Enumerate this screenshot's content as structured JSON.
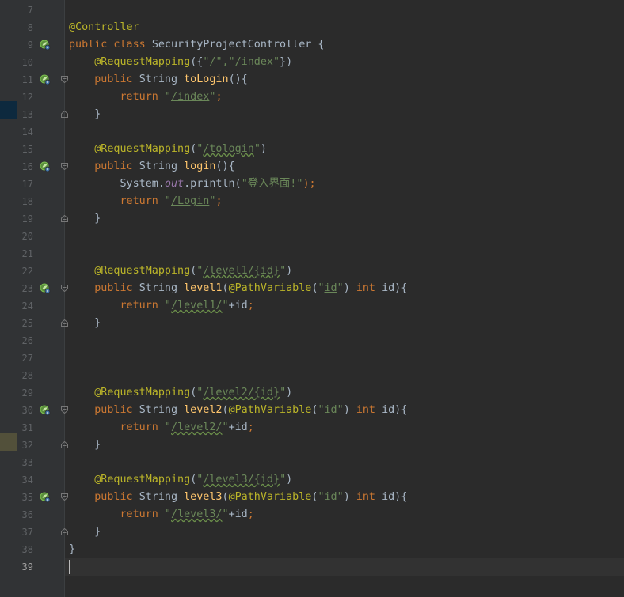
{
  "editor": {
    "first_line": 7,
    "current_line": 39,
    "colors": {
      "background": "#2b2b2b",
      "gutter": "#313335",
      "keyword": "#cc7832",
      "annotation": "#bbb529",
      "string": "#6a8759",
      "function": "#ffc66d",
      "field": "#9876aa",
      "text": "#a9b7c6"
    },
    "lines": [
      {
        "n": "7",
        "tokens": []
      },
      {
        "n": "8",
        "tokens": [
          {
            "t": "@Controller",
            "c": "ann"
          }
        ]
      },
      {
        "n": "9",
        "icon": "spring-bean-icon",
        "tokens": [
          {
            "t": "public class ",
            "c": "kw"
          },
          {
            "t": "SecurityProjectController {",
            "c": "plain"
          }
        ]
      },
      {
        "n": "10",
        "tokens": [
          {
            "t": "    "
          },
          {
            "t": "@RequestMapping",
            "c": "ann"
          },
          {
            "t": "({",
            "c": "plain"
          },
          {
            "t": "\"",
            "c": "str"
          },
          {
            "t": "/",
            "c": "strlink"
          },
          {
            "t": "\",\"",
            "c": "str"
          },
          {
            "t": "/index",
            "c": "strlink"
          },
          {
            "t": "\"",
            "c": "str"
          },
          {
            "t": "})",
            "c": "plain"
          }
        ]
      },
      {
        "n": "11",
        "icon": "request-mapping-icon",
        "fold": "open",
        "tokens": [
          {
            "t": "    "
          },
          {
            "t": "public ",
            "c": "kw"
          },
          {
            "t": "String ",
            "c": "plain"
          },
          {
            "t": "toLogin",
            "c": "fn"
          },
          {
            "t": "(){",
            "c": "plain"
          }
        ]
      },
      {
        "n": "12",
        "tokens": [
          {
            "t": "        "
          },
          {
            "t": "return ",
            "c": "kw"
          },
          {
            "t": "\"",
            "c": "str"
          },
          {
            "t": "/index",
            "c": "strlink"
          },
          {
            "t": "\"",
            "c": "str"
          },
          {
            "t": ";",
            "c": "kw"
          }
        ]
      },
      {
        "n": "13",
        "fold": "close",
        "tokens": [
          {
            "t": "    "
          },
          {
            "t": "}",
            "c": "plain"
          }
        ]
      },
      {
        "n": "14",
        "tokens": []
      },
      {
        "n": "15",
        "tokens": [
          {
            "t": "    "
          },
          {
            "t": "@RequestMapping",
            "c": "ann"
          },
          {
            "t": "(",
            "c": "plain"
          },
          {
            "t": "\"",
            "c": "str"
          },
          {
            "t": "/tologin",
            "c": "strlink wavy"
          },
          {
            "t": "\"",
            "c": "str"
          },
          {
            "t": ")",
            "c": "plain"
          }
        ]
      },
      {
        "n": "16",
        "icon": "request-mapping-icon",
        "fold": "open",
        "tokens": [
          {
            "t": "    "
          },
          {
            "t": "public ",
            "c": "kw"
          },
          {
            "t": "String ",
            "c": "plain"
          },
          {
            "t": "login",
            "c": "fn"
          },
          {
            "t": "(){",
            "c": "plain"
          }
        ]
      },
      {
        "n": "17",
        "tokens": [
          {
            "t": "        "
          },
          {
            "t": "System.",
            "c": "plain"
          },
          {
            "t": "out",
            "c": "field"
          },
          {
            "t": ".println(",
            "c": "plain"
          },
          {
            "t": "\"登入界面!\"",
            "c": "str"
          },
          {
            "t": ");",
            "c": "kw"
          }
        ]
      },
      {
        "n": "18",
        "tokens": [
          {
            "t": "        "
          },
          {
            "t": "return ",
            "c": "kw"
          },
          {
            "t": "\"",
            "c": "str"
          },
          {
            "t": "/Login",
            "c": "strlink"
          },
          {
            "t": "\"",
            "c": "str"
          },
          {
            "t": ";",
            "c": "kw"
          }
        ]
      },
      {
        "n": "19",
        "fold": "close",
        "tokens": [
          {
            "t": "    "
          },
          {
            "t": "}",
            "c": "plain"
          }
        ]
      },
      {
        "n": "20",
        "tokens": []
      },
      {
        "n": "21",
        "tokens": []
      },
      {
        "n": "22",
        "tokens": [
          {
            "t": "    "
          },
          {
            "t": "@RequestMapping",
            "c": "ann"
          },
          {
            "t": "(",
            "c": "plain"
          },
          {
            "t": "\"",
            "c": "str"
          },
          {
            "t": "/level1/{id}",
            "c": "strlink wavy"
          },
          {
            "t": "\"",
            "c": "str"
          },
          {
            "t": ")",
            "c": "plain"
          }
        ]
      },
      {
        "n": "23",
        "icon": "request-mapping-icon",
        "fold": "open",
        "tokens": [
          {
            "t": "    "
          },
          {
            "t": "public ",
            "c": "kw"
          },
          {
            "t": "String ",
            "c": "plain"
          },
          {
            "t": "level1",
            "c": "fn"
          },
          {
            "t": "(",
            "c": "plain"
          },
          {
            "t": "@PathVariable",
            "c": "ann"
          },
          {
            "t": "(",
            "c": "plain"
          },
          {
            "t": "\"",
            "c": "str"
          },
          {
            "t": "id",
            "c": "strlink"
          },
          {
            "t": "\"",
            "c": "str"
          },
          {
            "t": ") ",
            "c": "plain"
          },
          {
            "t": "int ",
            "c": "kw"
          },
          {
            "t": "id){",
            "c": "plain"
          }
        ]
      },
      {
        "n": "24",
        "tokens": [
          {
            "t": "        "
          },
          {
            "t": "return ",
            "c": "kw"
          },
          {
            "t": "\"",
            "c": "str"
          },
          {
            "t": "/level1/",
            "c": "str wavy"
          },
          {
            "t": "\"",
            "c": "str"
          },
          {
            "t": "+id",
            "c": "plain"
          },
          {
            "t": ";",
            "c": "kw"
          }
        ]
      },
      {
        "n": "25",
        "fold": "close",
        "tokens": [
          {
            "t": "    "
          },
          {
            "t": "}",
            "c": "plain"
          }
        ]
      },
      {
        "n": "26",
        "tokens": []
      },
      {
        "n": "27",
        "tokens": []
      },
      {
        "n": "28",
        "tokens": []
      },
      {
        "n": "29",
        "tokens": [
          {
            "t": "    "
          },
          {
            "t": "@RequestMapping",
            "c": "ann"
          },
          {
            "t": "(",
            "c": "plain"
          },
          {
            "t": "\"",
            "c": "str"
          },
          {
            "t": "/level2/{id}",
            "c": "strlink wavy"
          },
          {
            "t": "\"",
            "c": "str"
          },
          {
            "t": ")",
            "c": "plain"
          }
        ]
      },
      {
        "n": "30",
        "icon": "request-mapping-icon",
        "fold": "open",
        "tokens": [
          {
            "t": "    "
          },
          {
            "t": "public ",
            "c": "kw"
          },
          {
            "t": "String ",
            "c": "plain"
          },
          {
            "t": "level2",
            "c": "fn"
          },
          {
            "t": "(",
            "c": "plain"
          },
          {
            "t": "@PathVariable",
            "c": "ann"
          },
          {
            "t": "(",
            "c": "plain"
          },
          {
            "t": "\"",
            "c": "str"
          },
          {
            "t": "id",
            "c": "strlink"
          },
          {
            "t": "\"",
            "c": "str"
          },
          {
            "t": ") ",
            "c": "plain"
          },
          {
            "t": "int ",
            "c": "kw"
          },
          {
            "t": "id){",
            "c": "plain"
          }
        ]
      },
      {
        "n": "31",
        "tokens": [
          {
            "t": "        "
          },
          {
            "t": "return ",
            "c": "kw"
          },
          {
            "t": "\"",
            "c": "str"
          },
          {
            "t": "/level2/",
            "c": "str wavy"
          },
          {
            "t": "\"",
            "c": "str"
          },
          {
            "t": "+id",
            "c": "plain"
          },
          {
            "t": ";",
            "c": "kw"
          }
        ]
      },
      {
        "n": "32",
        "fold": "close",
        "tokens": [
          {
            "t": "    "
          },
          {
            "t": "}",
            "c": "plain"
          }
        ]
      },
      {
        "n": "33",
        "tokens": []
      },
      {
        "n": "34",
        "tokens": [
          {
            "t": "    "
          },
          {
            "t": "@RequestMapping",
            "c": "ann"
          },
          {
            "t": "(",
            "c": "plain"
          },
          {
            "t": "\"",
            "c": "str"
          },
          {
            "t": "/level3/{id}",
            "c": "strlink wavy"
          },
          {
            "t": "\"",
            "c": "str"
          },
          {
            "t": ")",
            "c": "plain"
          }
        ]
      },
      {
        "n": "35",
        "icon": "request-mapping-icon",
        "fold": "open",
        "tokens": [
          {
            "t": "    "
          },
          {
            "t": "public ",
            "c": "kw"
          },
          {
            "t": "String ",
            "c": "plain"
          },
          {
            "t": "level3",
            "c": "fn"
          },
          {
            "t": "(",
            "c": "plain"
          },
          {
            "t": "@PathVariable",
            "c": "ann"
          },
          {
            "t": "(",
            "c": "plain"
          },
          {
            "t": "\"",
            "c": "str"
          },
          {
            "t": "id",
            "c": "strlink"
          },
          {
            "t": "\"",
            "c": "str"
          },
          {
            "t": ") ",
            "c": "plain"
          },
          {
            "t": "int ",
            "c": "kw"
          },
          {
            "t": "id){",
            "c": "plain"
          }
        ]
      },
      {
        "n": "36",
        "tokens": [
          {
            "t": "        "
          },
          {
            "t": "return ",
            "c": "kw"
          },
          {
            "t": "\"",
            "c": "str"
          },
          {
            "t": "/level3/",
            "c": "str wavy"
          },
          {
            "t": "\"",
            "c": "str"
          },
          {
            "t": "+id",
            "c": "plain"
          },
          {
            "t": ";",
            "c": "kw"
          }
        ]
      },
      {
        "n": "37",
        "fold": "close",
        "tokens": [
          {
            "t": "    "
          },
          {
            "t": "}",
            "c": "plain"
          }
        ]
      },
      {
        "n": "38",
        "tokens": [
          {
            "t": "}",
            "c": "plain"
          }
        ]
      },
      {
        "n": "39",
        "tokens": []
      }
    ]
  }
}
